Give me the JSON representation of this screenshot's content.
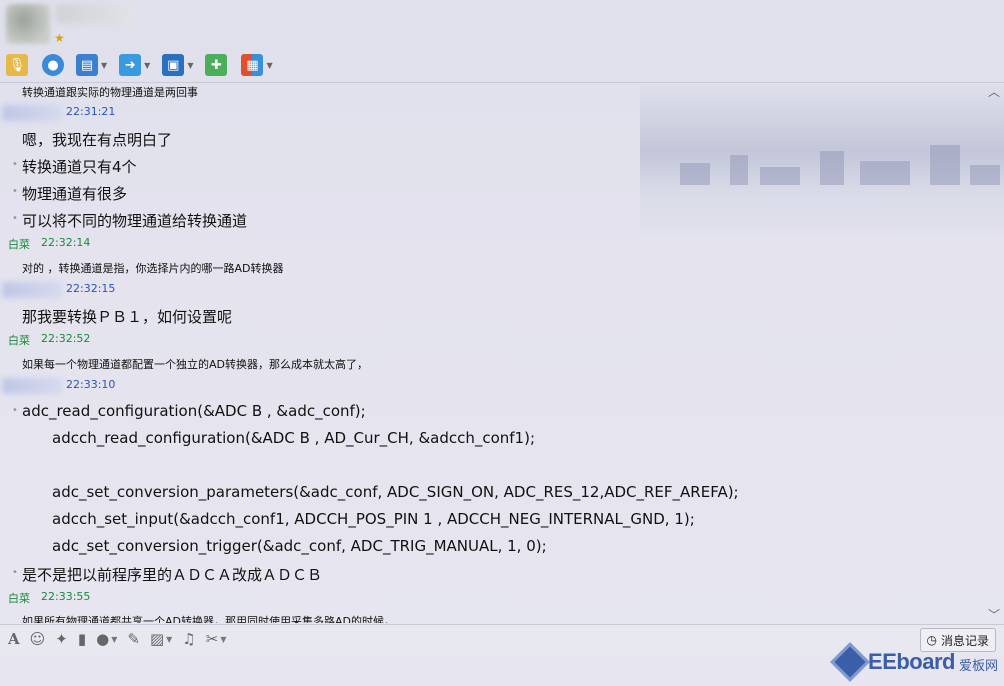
{
  "header": {
    "toolbar": [
      {
        "name": "voice-icon",
        "dropdown": false,
        "color": "#e0a020"
      },
      {
        "name": "video-icon",
        "dropdown": false,
        "color": "#2a7fd0"
      },
      {
        "name": "screen-share-icon",
        "dropdown": true,
        "color": "#2a6fc0"
      },
      {
        "name": "file-transfer-icon",
        "dropdown": true,
        "color": "#2a8ad8"
      },
      {
        "name": "remote-desktop-icon",
        "dropdown": true,
        "color": "#2a6fc0"
      },
      {
        "name": "create-discussion-icon",
        "dropdown": false,
        "color": "#3aa050"
      },
      {
        "name": "apps-icon",
        "dropdown": true,
        "color": "#e05030"
      }
    ]
  },
  "messages": {
    "m0": {
      "text": "转换通道跟实际的物理通道是两回事"
    },
    "m1": {
      "time": "22:31:21",
      "lines": [
        "嗯，我现在有点明白了",
        "转换通道只有4个",
        "物理通道有很多",
        "可以将不同的物理通道给转换通道"
      ]
    },
    "m2": {
      "sender": "白菜",
      "time": "22:32:14",
      "text": "对的 ，转换通道是指，你选择片内的哪一路AD转换器"
    },
    "m3": {
      "time": "22:32:15",
      "text": "那我要转换ＰＢ１，如何设置呢"
    },
    "m4": {
      "sender": "白菜",
      "time": "22:32:52",
      "text": "如果每一个物理通道都配置一个独立的AD转换器，那么成本就太高了，"
    },
    "m5": {
      "time": "22:33:10",
      "lines": [
        "adc_read_configuration(&ADC B , &adc_conf);",
        "adcch_read_configuration(&ADC B , AD_Cur_CH, &adcch_conf1);",
        "adc_set_conversion_parameters(&adc_conf, ADC_SIGN_ON, ADC_RES_12,ADC_REF_AREFA);",
        "adcch_set_input(&adcch_conf1, ADCCH_POS_PIN 1 , ADCCH_NEG_INTERNAL_GND, 1);",
        "adc_set_conversion_trigger(&adc_conf, ADC_TRIG_MANUAL, 1, 0);",
        "是不是把以前程序里的ＡＤＣＡ改成ＡＤＣＢ"
      ]
    },
    "m6": {
      "sender": "白菜",
      "time": "22:33:55",
      "text": "如果所有物理通道都共享一个AD转换器，那用同时使用采集多路AD的时候，"
    }
  },
  "input_toolbar": {
    "history_label": "消息记录"
  },
  "watermark": {
    "brand": "EEboard",
    "sub": "爱板网"
  }
}
